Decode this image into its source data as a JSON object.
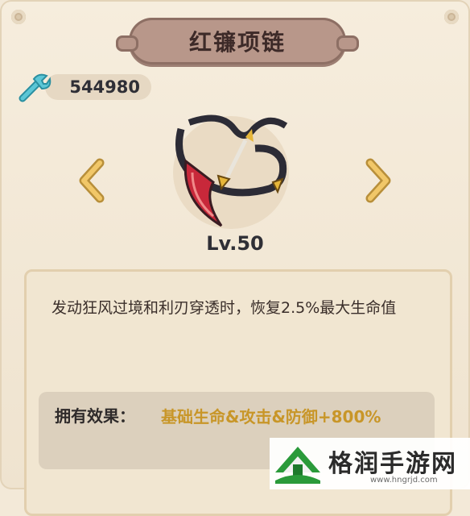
{
  "title": "红镰项链",
  "currency": {
    "value": "544980",
    "icon": "wrench-icon"
  },
  "navigation": {
    "prev_icon": "chevron-left-icon",
    "next_icon": "chevron-right-icon"
  },
  "item": {
    "icon": "scythe-necklace-icon",
    "level": "Lv.50"
  },
  "description": "发动狂风过境和利刃穿透时，恢复2.5%最大生命值",
  "effect": {
    "label": "拥有效果：",
    "value": "基础生命&攻击&防御+800%"
  },
  "watermark": {
    "text": "格润手游网",
    "url": "www.hngrjd.com"
  },
  "colors": {
    "accent_gold": "#c89628",
    "banner": "#b8978a",
    "panel": "#f3e9d8",
    "wrench": "#4fb8c9"
  }
}
